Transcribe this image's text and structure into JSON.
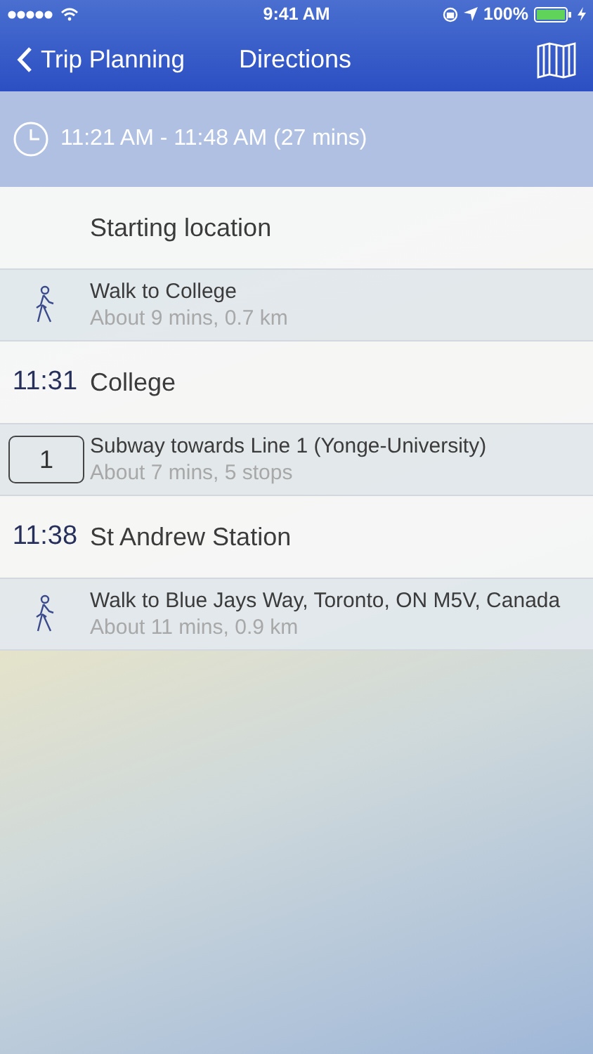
{
  "status_bar": {
    "time": "9:41 AM",
    "battery": "100%"
  },
  "nav": {
    "back": "Trip Planning",
    "title": "Directions"
  },
  "summary": {
    "text": "11:21 AM - 11:48 AM (27 mins)"
  },
  "steps": [
    {
      "kind": "stop",
      "name": "Starting location"
    },
    {
      "kind": "walk",
      "title": "Walk to College",
      "detail": "About 9 mins, 0.7 km"
    },
    {
      "kind": "stop",
      "time": "11:31",
      "name": "College"
    },
    {
      "kind": "transit",
      "route": "1",
      "title": "Subway towards Line 1 (Yonge-University)",
      "detail": "About 7 mins, 5 stops"
    },
    {
      "kind": "stop",
      "time": "11:38",
      "name": "St Andrew Station"
    },
    {
      "kind": "walk",
      "title": "Walk to Blue Jays Way, Toronto, ON M5V, Canada",
      "detail": "About 11 mins, 0.9 km"
    }
  ]
}
